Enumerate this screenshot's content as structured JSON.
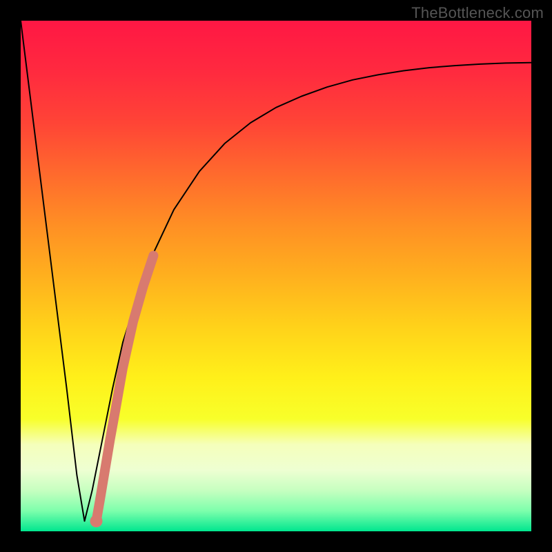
{
  "watermark": "TheBottleneck.com",
  "colors": {
    "frame": "#000000",
    "curve": "#000000",
    "highlight": "#d87a6f",
    "gradient_stops": [
      {
        "offset": 0.0,
        "color": "#ff1744"
      },
      {
        "offset": 0.1,
        "color": "#ff2a3f"
      },
      {
        "offset": 0.2,
        "color": "#ff4436"
      },
      {
        "offset": 0.3,
        "color": "#ff6a2d"
      },
      {
        "offset": 0.4,
        "color": "#ff8f24"
      },
      {
        "offset": 0.5,
        "color": "#ffb01e"
      },
      {
        "offset": 0.6,
        "color": "#ffd21a"
      },
      {
        "offset": 0.7,
        "color": "#fff01a"
      },
      {
        "offset": 0.78,
        "color": "#f8ff2a"
      },
      {
        "offset": 0.83,
        "color": "#f5ffbb"
      },
      {
        "offset": 0.88,
        "color": "#eeffd2"
      },
      {
        "offset": 0.92,
        "color": "#c6ffc0"
      },
      {
        "offset": 0.96,
        "color": "#7dffac"
      },
      {
        "offset": 1.0,
        "color": "#00e68f"
      }
    ]
  },
  "chart_data": {
    "type": "line",
    "title": "",
    "xlabel": "",
    "ylabel": "",
    "xlim": [
      0,
      100
    ],
    "ylim": [
      0,
      100
    ],
    "note": "x/y are in percent of plot width/height; y is plotted downward (0 at top). Curve is a bottleneck-style V: steep linear drop on the left, minimum near x≈12, then asymptotic rise saturating toward ~92.",
    "series": [
      {
        "name": "bottleneck-curve",
        "x": [
          0,
          3,
          6,
          9,
          11,
          12.5,
          14,
          16,
          18,
          20,
          23,
          26,
          30,
          35,
          40,
          45,
          50,
          55,
          60,
          65,
          70,
          75,
          80,
          85,
          90,
          95,
          100
        ],
        "y": [
          0,
          24,
          48,
          72,
          89,
          98,
          92,
          82,
          72,
          63,
          53.5,
          45.5,
          37,
          29.5,
          24,
          20,
          17,
          14.8,
          13,
          11.6,
          10.6,
          9.8,
          9.2,
          8.8,
          8.5,
          8.3,
          8.2
        ]
      },
      {
        "name": "highlight-segment",
        "x": [
          14.8,
          15.5,
          16.5,
          17.5,
          18.5,
          20.0,
          22.0,
          24.0,
          26.0
        ],
        "y": [
          98,
          94,
          88,
          82,
          76.5,
          68,
          59,
          52,
          46
        ]
      }
    ]
  }
}
